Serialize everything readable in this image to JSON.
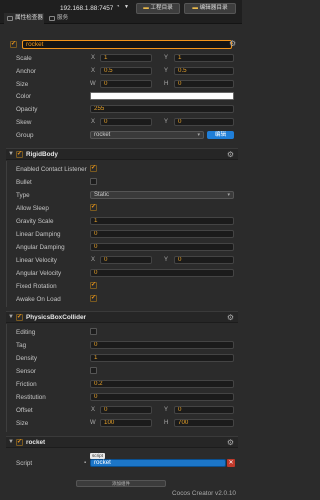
{
  "topbar": {
    "address": "192.168.1.88:7457",
    "wifi_icon": "wifi-icon",
    "project_label": "工程目录",
    "editor_label": "编辑器目录"
  },
  "tabs": [
    {
      "label": "属性检查器"
    },
    {
      "label": "服务"
    }
  ],
  "node": {
    "enabled": true,
    "name": "rocket"
  },
  "node_props": {
    "scale": {
      "label": "Scale",
      "x": "1",
      "y": "1"
    },
    "anchor": {
      "label": "Anchor",
      "x": "0.5",
      "y": "0.5"
    },
    "size": {
      "label": "Size",
      "w": "0",
      "h": "0"
    },
    "color": {
      "label": "Color",
      "value": "#ffffff"
    },
    "opacity": {
      "label": "Opacity",
      "value": "255"
    },
    "skew": {
      "label": "Skew",
      "x": "0",
      "y": "0"
    },
    "group": {
      "label": "Group",
      "value": "rocket",
      "edit_label": "编辑"
    }
  },
  "axis": {
    "x": "X",
    "y": "Y",
    "w": "W",
    "h": "H"
  },
  "rigidbody": {
    "title": "RigidBody",
    "enabled_contact_listener": {
      "label": "Enabled Contact Listener",
      "checked": true
    },
    "bullet": {
      "label": "Bullet",
      "checked": false
    },
    "type": {
      "label": "Type",
      "value": "Static"
    },
    "allow_sleep": {
      "label": "Allow Sleep",
      "checked": true
    },
    "gravity_scale": {
      "label": "Gravity Scale",
      "value": "1"
    },
    "linear_damping": {
      "label": "Linear Damping",
      "value": "0"
    },
    "angular_damping": {
      "label": "Angular Damping",
      "value": "0"
    },
    "linear_velocity": {
      "label": "Linear Velocity",
      "x": "0",
      "y": "0"
    },
    "angular_velocity": {
      "label": "Angular Velocity",
      "value": "0"
    },
    "fixed_rotation": {
      "label": "Fixed Rotation",
      "checked": true
    },
    "awake_on_load": {
      "label": "Awake On Load",
      "checked": true
    }
  },
  "physicsbox": {
    "title": "PhysicsBoxCollider",
    "editing": {
      "label": "Editing",
      "checked": false
    },
    "tag": {
      "label": "Tag",
      "value": "0"
    },
    "density": {
      "label": "Density",
      "value": "1"
    },
    "sensor": {
      "label": "Sensor",
      "checked": false
    },
    "friction": {
      "label": "Friction",
      "value": "0.2"
    },
    "restitution": {
      "label": "Restitution",
      "value": "0"
    },
    "offset": {
      "label": "Offset",
      "x": "0",
      "y": "0"
    },
    "size": {
      "label": "Size",
      "w": "100",
      "h": "700"
    }
  },
  "script_comp": {
    "title": "rocket",
    "script_label": "Script",
    "tag": "script",
    "value": "rocket",
    "close": "✕"
  },
  "add_component_label": "添加组件",
  "footer": "Cocos Creator v2.0.10",
  "colors": {
    "accent": "#f59a1a",
    "blue": "#1f7ed8",
    "bg": "#2b2b2b"
  }
}
